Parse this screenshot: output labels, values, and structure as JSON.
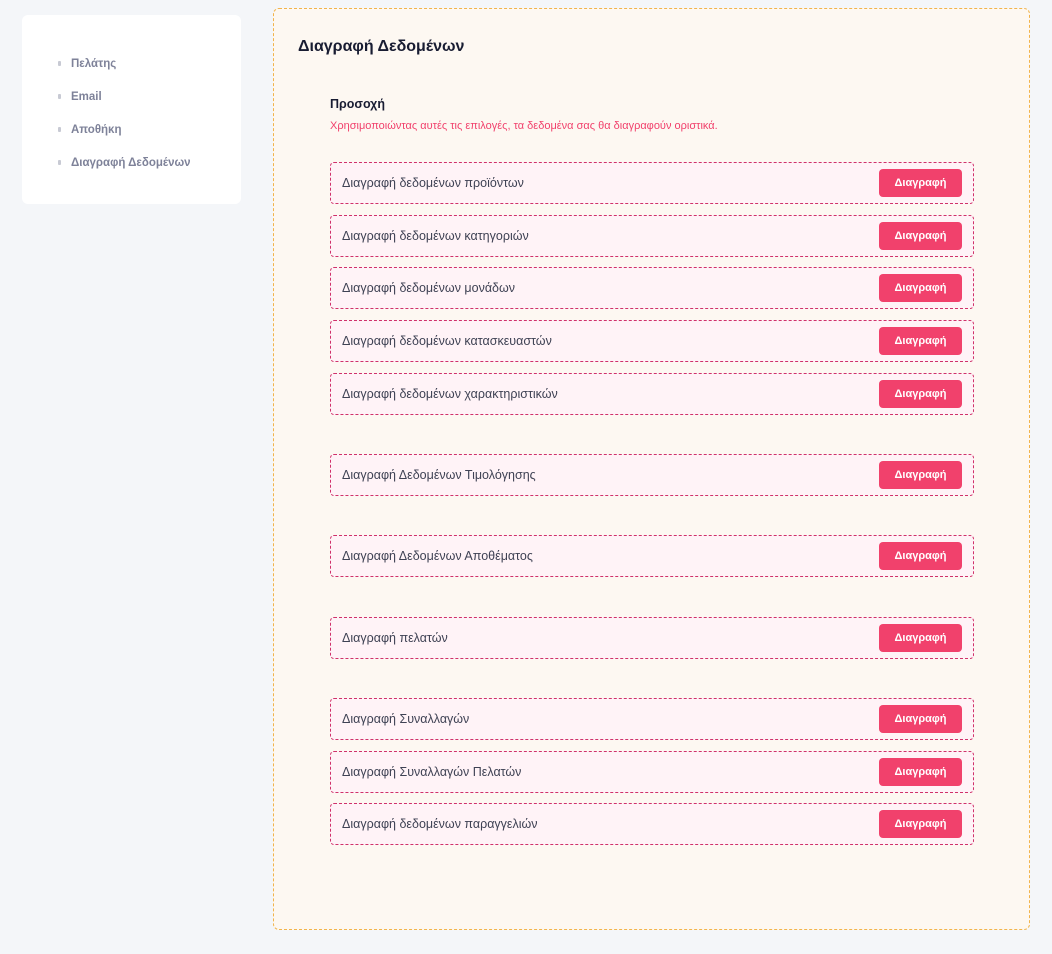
{
  "sidebar": {
    "items": [
      {
        "label": "Πελάτης"
      },
      {
        "label": "Email"
      },
      {
        "label": "Αποθήκη"
      },
      {
        "label": "Διαγραφή Δεδομένων"
      }
    ]
  },
  "main": {
    "title": "Διαγραφή Δεδομένων",
    "warning_title": "Προσοχή",
    "warning_text": "Χρησιμοποιώντας αυτές τις επιλογές, τα δεδομένα σας θα διαγραφούν οριστικά.",
    "button_label": "Διαγραφή",
    "rows": [
      {
        "label": "Διαγραφή δεδομένων προϊόντων"
      },
      {
        "label": "Διαγραφή δεδομένων κατηγοριών"
      },
      {
        "label": "Διαγραφή δεδομένων μονάδων"
      },
      {
        "label": "Διαγραφή δεδομένων κατασκευαστών"
      },
      {
        "label": "Διαγραφή δεδομένων χαρακτηριστικών"
      },
      {
        "label": "Διαγραφή Δεδομένων Τιμολόγησης"
      },
      {
        "label": "Διαγραφή Δεδομένων Αποθέματος"
      },
      {
        "label": "Διαγραφή πελατών"
      },
      {
        "label": "Διαγραφή Συναλλαγών"
      },
      {
        "label": "Διαγραφή Συναλλαγών Πελατών"
      },
      {
        "label": "Διαγραφή δεδομένων παραγγελιών"
      }
    ]
  },
  "colors": {
    "accent": "#f1416c",
    "panel_bg": "#fdf8f2",
    "panel_border": "#f2b44b",
    "row_bg": "#fff3f7"
  }
}
